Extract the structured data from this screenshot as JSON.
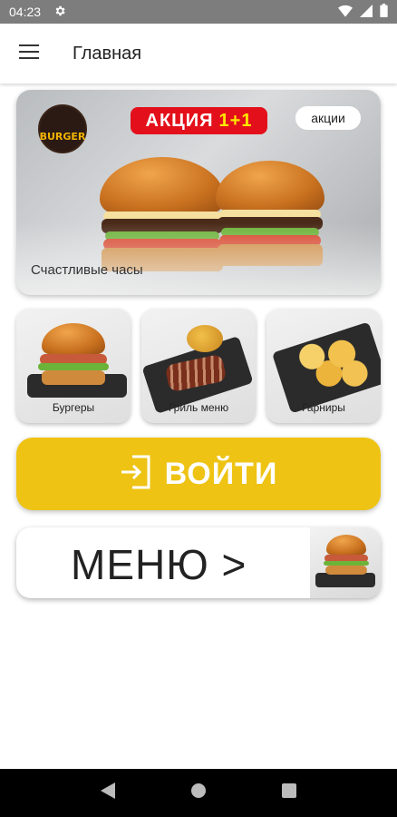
{
  "status_bar": {
    "time": "04:23"
  },
  "app_bar": {
    "title": "Главная"
  },
  "promo": {
    "logo_text": "BURGER",
    "badge_text": "АКЦИЯ",
    "badge_number": "1+1",
    "chip_label": "акции",
    "caption": "Счастливые часы"
  },
  "categories": [
    {
      "label": "Бургеры"
    },
    {
      "label": "Гриль меню"
    },
    {
      "label": "Гарниры"
    }
  ],
  "login": {
    "label": "ВОЙТИ"
  },
  "menu": {
    "label": "МЕНЮ >"
  },
  "colors": {
    "login_yellow": "#eec313",
    "badge_red": "#e3101b",
    "status_bar": "#7d7d7d"
  }
}
